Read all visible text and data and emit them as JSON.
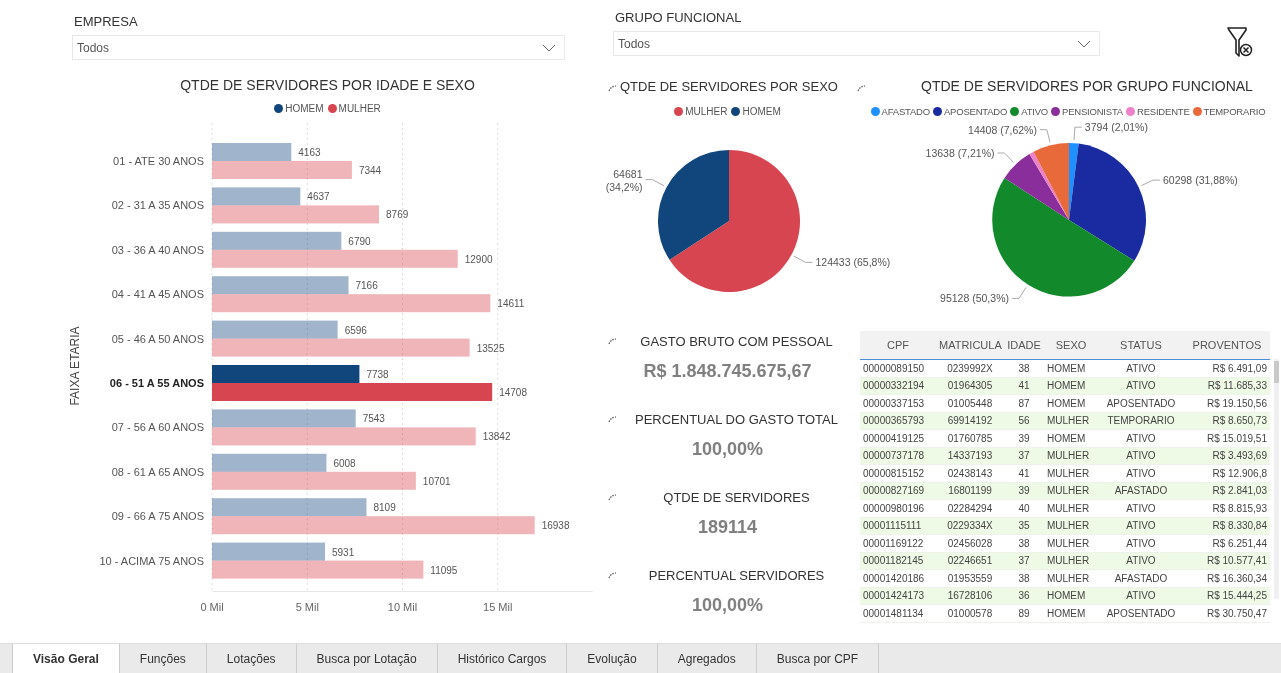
{
  "filters": [
    {
      "label": "EMPRESA",
      "value": "Todos"
    },
    {
      "label": "GRUPO FUNCIONAL",
      "value": "Todos"
    }
  ],
  "faixa_chart": {
    "title": "QTDE DE SERVIDORES POR IDADE E SEXO",
    "selected_rows": [
      false,
      false,
      false,
      false,
      false,
      true,
      false,
      false,
      false,
      false
    ],
    "chart_data": {
      "type": "bar",
      "orientation": "horizontal",
      "ylabel": "FAIXA ETARIA",
      "categories": [
        "01 - ATE 30 ANOS",
        "02 - 31 A 35 ANOS",
        "03 - 36 A 40 ANOS",
        "04 - 41 A 45 ANOS",
        "05 - 46 A 50 ANOS",
        "06 - 51 A 55 ANOS",
        "07 - 56 A 60 ANOS",
        "08 - 61 A 65 ANOS",
        "09 - 66 A 75 ANOS",
        "10 - ACIMA 75 ANOS"
      ],
      "series": [
        {
          "name": "HOMEM",
          "color": "#11467c",
          "values": [
            4.163,
            4.637,
            6.79,
            7.166,
            6.596,
            7.738,
            7.543,
            6.008,
            8.109,
            5.931
          ]
        },
        {
          "name": "MULHER",
          "color": "#d64550",
          "values": [
            7.344,
            8.769,
            12.9,
            14.611,
            13.525,
            14.708,
            13.842,
            10.701,
            16.938,
            11.095
          ]
        }
      ],
      "value_labels": [
        [
          "4163",
          "4637",
          "6790",
          "7166",
          "6596",
          "7738",
          "7543",
          "6008",
          "8109",
          "5931"
        ],
        [
          "7344",
          "8769",
          "12900",
          "14611",
          "13525",
          "14708",
          "13842",
          "10701",
          "16938",
          "11095"
        ]
      ],
      "grid": true,
      "xlim": [
        0,
        20
      ],
      "xticks": [
        {
          "value": 0,
          "label": "0 Mil"
        },
        {
          "value": 5,
          "label": "5 Mil"
        },
        {
          "value": 10,
          "label": "10 Mil"
        },
        {
          "value": 15,
          "label": "15 Mil"
        }
      ],
      "stacked": false
    }
  },
  "sexo_chart": {
    "title": "QTDE DE SERVIDORES POR SEXO",
    "legend": [
      {
        "label": "MULHER",
        "color": "#d64550"
      },
      {
        "label": "HOMEM",
        "color": "#11467c"
      }
    ],
    "chart_data": {
      "type": "pie",
      "values": [
        65.8,
        34.2
      ],
      "value_labels": [
        "124433 (65,8%)",
        "64681 (34,2%)"
      ]
    }
  },
  "grupo_chart": {
    "title": "QTDE DE SERVIDORES POR GRUPO FUNCIONAL",
    "legend": [
      {
        "label": "AFASTADO",
        "color": "#1e90ff"
      },
      {
        "label": "APOSENTADO",
        "color": "#1a2aa0"
      },
      {
        "label": "ATIVO",
        "color": "#128a2c"
      },
      {
        "label": "PENSIONISTA",
        "color": "#8a2e9c"
      },
      {
        "label": "RESIDENTE",
        "color": "#ee82c8"
      },
      {
        "label": "TEMPORARIO",
        "color": "#e8693a"
      }
    ],
    "chart_data": {
      "type": "pie",
      "values": [
        2.01,
        31.88,
        50.3,
        7.21,
        0.98,
        7.62
      ],
      "value_labels": [
        "3794 (2,01%)",
        "60298 (31,88%)",
        "95128 (50,3%)",
        "13638 (7,21%)",
        null,
        "14408 (7,62%)"
      ]
    }
  },
  "kpis": [
    {
      "title": "GASTO BRUTO COM PESSOAL",
      "value": "R$ 1.848.745.675,67"
    },
    {
      "title": "PERCENTUAL DO GASTO TOTAL",
      "value": "100,00%"
    },
    {
      "title": "QTDE DE SERVIDORES",
      "value": "189114"
    },
    {
      "title": "PERCENTUAL SERVIDORES",
      "value": "100,00%"
    }
  ],
  "table": {
    "columns": [
      "CPF",
      "MATRICULA",
      "IDADE",
      "SEXO",
      "STATUS",
      "PROVENTOS"
    ],
    "rows": [
      [
        "00000089150",
        "0239992X",
        "38",
        "HOMEM",
        "ATIVO",
        "R$ 6.491,09"
      ],
      [
        "00000332194",
        "01964305",
        "41",
        "HOMEM",
        "ATIVO",
        "R$ 11.685,33"
      ],
      [
        "00000337153",
        "01005448",
        "87",
        "HOMEM",
        "APOSENTADO",
        "R$ 19.150,56"
      ],
      [
        "00000365793",
        "69914192",
        "56",
        "MULHER",
        "TEMPORARIO",
        "R$ 8.650,73"
      ],
      [
        "00000419125",
        "01760785",
        "39",
        "HOMEM",
        "ATIVO",
        "R$ 15.019,51"
      ],
      [
        "00000737178",
        "14337193",
        "37",
        "MULHER",
        "ATIVO",
        "R$ 3.493,69"
      ],
      [
        "00000815152",
        "02438143",
        "41",
        "MULHER",
        "ATIVO",
        "R$ 12.906,8"
      ],
      [
        "00000827169",
        "16801199",
        "39",
        "MULHER",
        "AFASTADO",
        "R$ 2.841,03"
      ],
      [
        "00000980196",
        "02284294",
        "40",
        "MULHER",
        "ATIVO",
        "R$ 8.815,93"
      ],
      [
        "00001115111",
        "0229334X",
        "35",
        "MULHER",
        "ATIVO",
        "R$ 8.330,84"
      ],
      [
        "00001169122",
        "02456028",
        "38",
        "MULHER",
        "ATIVO",
        "R$ 6.251,44"
      ],
      [
        "00001182145",
        "02246651",
        "37",
        "MULHER",
        "ATIVO",
        "R$ 10.577,41"
      ],
      [
        "00001420186",
        "01953559",
        "38",
        "MULHER",
        "AFASTADO",
        "R$ 16.360,34"
      ],
      [
        "00001424173",
        "16728106",
        "36",
        "HOMEM",
        "ATIVO",
        "R$ 15.444,25"
      ],
      [
        "00001481134",
        "01000578",
        "89",
        "HOMEM",
        "APOSENTADO",
        "R$ 30.750,47"
      ]
    ]
  },
  "tabs": [
    {
      "label": "Visão Geral",
      "selected": true
    },
    {
      "label": "Funções",
      "selected": false
    },
    {
      "label": "Lotações",
      "selected": false
    },
    {
      "label": "Busca por Lotação",
      "selected": false
    },
    {
      "label": "Histórico Cargos",
      "selected": false
    },
    {
      "label": "Evolução",
      "selected": false
    },
    {
      "label": "Agregados",
      "selected": false
    },
    {
      "label": "Busca por CPF",
      "selected": false
    }
  ]
}
